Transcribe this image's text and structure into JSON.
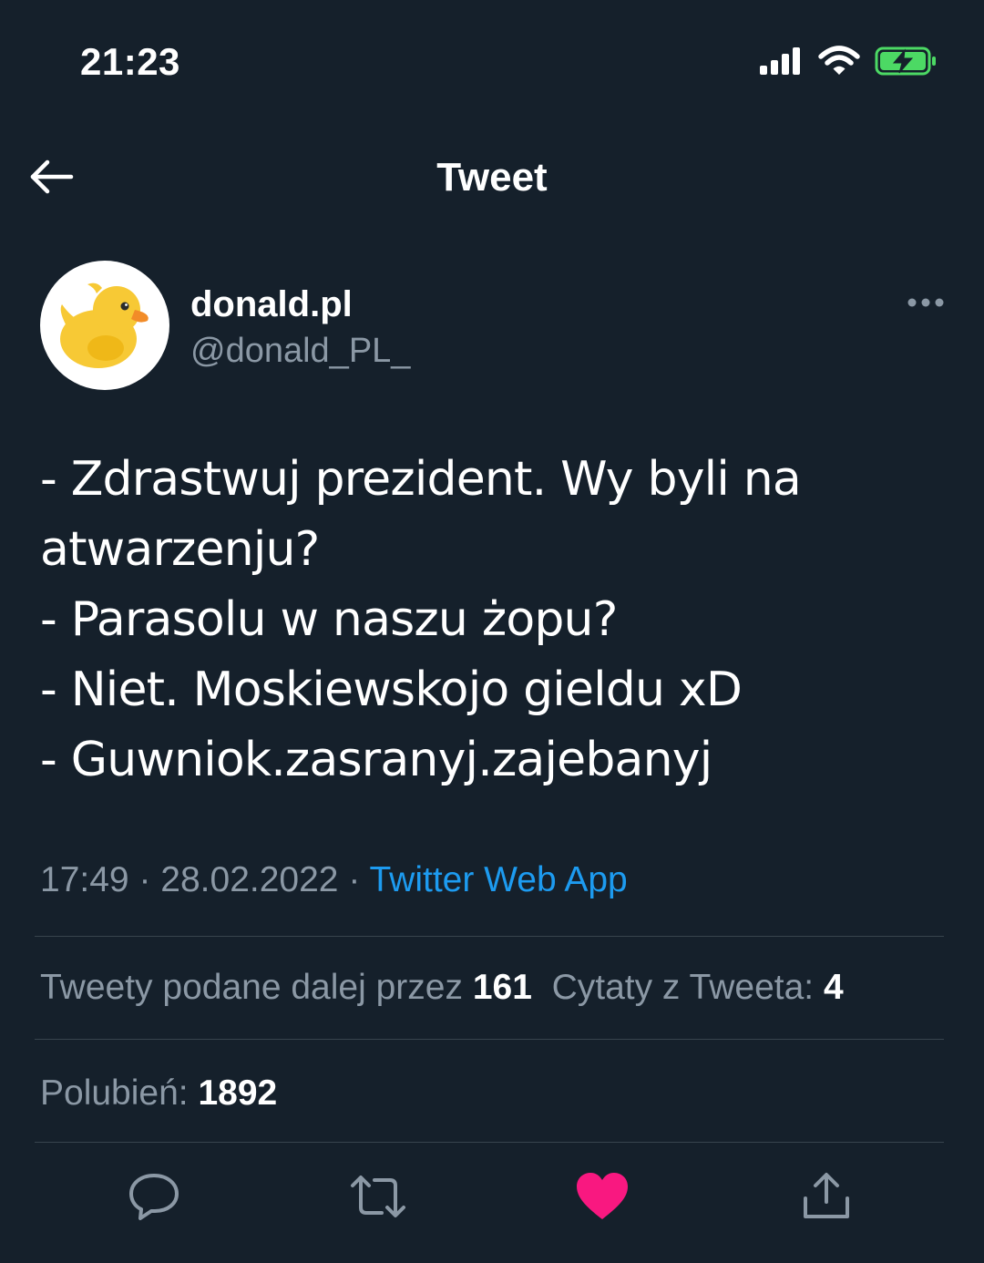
{
  "status_bar": {
    "time": "21:23",
    "icons": [
      "signal-icon",
      "wifi-icon",
      "battery-charging-icon"
    ]
  },
  "header": {
    "title": "Tweet",
    "back_icon": "back-arrow-icon"
  },
  "tweet": {
    "author": {
      "display_name": "donald.pl",
      "handle": "@donald_PL_",
      "avatar_icon": "rubber-duck-avatar"
    },
    "text": "- Zdrastwuj prezident. Wy byli na\natwarzenju?\n- Parasolu w naszu żopu?\n- Niet. Moskiewskojo gieldu xD\n- Guwniok.zasranyj.zajebanyj",
    "time": "17:49",
    "separator": "·",
    "date": "28.02.2022",
    "source": "Twitter Web App"
  },
  "stats": {
    "retweets_label": "Tweety podane dalej przez",
    "retweets_value": "161",
    "quotes_label": "Cytaty z Tweeta:",
    "quotes_value": "4",
    "likes_label": "Polubień:",
    "likes_value": "1892"
  },
  "actions": [
    "reply-icon",
    "retweet-icon",
    "like-icon",
    "share-icon"
  ],
  "colors": {
    "background": "#15202b",
    "text_primary": "#ffffff",
    "text_secondary": "#8b98a5",
    "link": "#1d9bf0",
    "like_active": "#f91880",
    "divider": "#38444d",
    "battery_green": "#4cd964"
  }
}
